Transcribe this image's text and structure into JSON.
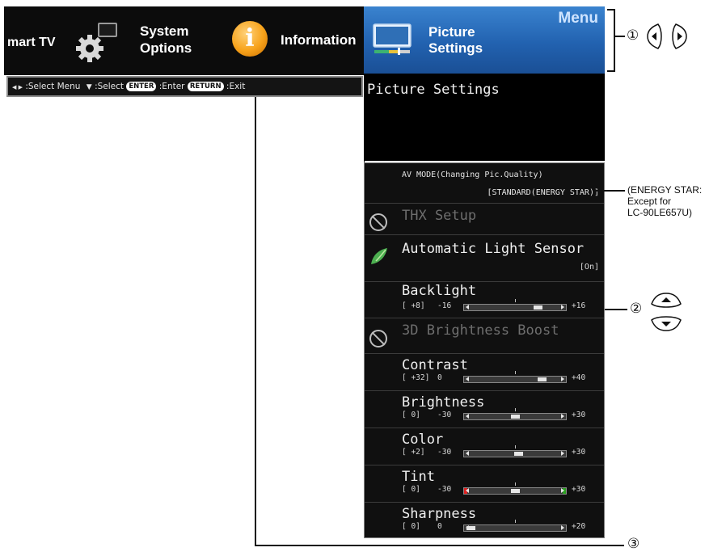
{
  "topbar": {
    "smart_tv": "mart TV",
    "system_options_line1": "System",
    "system_options_line2": "Options",
    "information": "Information"
  },
  "helpbar": {
    "select_menu": ":Select Menu",
    "select": ":Select",
    "enter_key": "ENTER",
    "enter": ":Enter",
    "return_key": "RETURN",
    "exit": ":Exit"
  },
  "menu": {
    "menu_word": "Menu",
    "tab_line1": "Picture",
    "tab_line2": "Settings",
    "submenu_title": "Picture Settings"
  },
  "items": {
    "av_mode_label": "AV MODE(Changing Pic.Quality)",
    "av_mode_value": "[STANDARD(ENERGY STAR)]",
    "thx": "THX Setup",
    "auto_light": "Automatic Light Sensor",
    "auto_light_value": "[On]",
    "boost": "3D Brightness Boost",
    "sliders": [
      {
        "label": "Backlight",
        "current": "[  +8]",
        "min": "-16",
        "max": "+16",
        "value": 8,
        "lo": -16,
        "hi": 16
      },
      {
        "label": "Contrast",
        "current": "[ +32]",
        "min": "0",
        "max": "+40",
        "value": 32,
        "lo": 0,
        "hi": 40
      },
      {
        "label": "Brightness",
        "current": "[   0]",
        "min": "-30",
        "max": "+30",
        "value": 0,
        "lo": -30,
        "hi": 30
      },
      {
        "label": "Color",
        "current": "[  +2]",
        "min": "-30",
        "max": "+30",
        "value": 2,
        "lo": -30,
        "hi": 30
      },
      {
        "label": "Tint",
        "current": "[   0]",
        "min": "-30",
        "max": "+30",
        "value": 0,
        "lo": -30,
        "hi": 30
      },
      {
        "label": "Sharpness",
        "current": "[   0]",
        "min": "0",
        "max": "+20",
        "value": 0,
        "lo": 0,
        "hi": 20
      }
    ]
  },
  "callouts": {
    "one": "①",
    "two": "②",
    "three": "③",
    "energy_star_line1": "(ENERGY STAR:",
    "energy_star_line2": "Except for",
    "energy_star_line3": "LC-90LE657U)"
  }
}
